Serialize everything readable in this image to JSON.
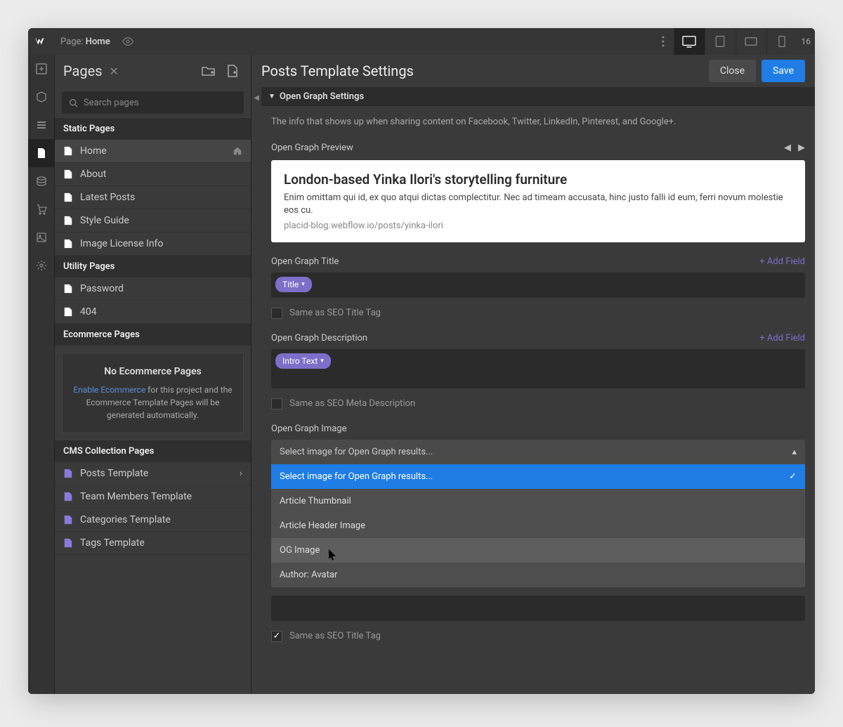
{
  "topbar": {
    "page_prefix": "Page:",
    "page_name": "Home",
    "resolution": "16"
  },
  "pages_panel": {
    "title": "Pages",
    "search_placeholder": "Search pages",
    "sections": {
      "static": "Static Pages",
      "utility": "Utility Pages",
      "ecommerce": "Ecommerce Pages",
      "cms": "CMS Collection Pages"
    },
    "static_items": [
      "Home",
      "About",
      "Latest Posts",
      "Style Guide",
      "Image License Info"
    ],
    "utility_items": [
      "Password",
      "404"
    ],
    "ecommerce_empty": {
      "title": "No Ecommerce Pages",
      "link": "Enable Ecommerce",
      "text_after": " for this project and the Ecommerce Template Pages will be generated automatically."
    },
    "cms_items": [
      "Posts Template",
      "Team Members Template",
      "Categories Template",
      "Tags Template"
    ]
  },
  "settings": {
    "title": "Posts Template Settings",
    "close": "Close",
    "save": "Save",
    "section": "Open Graph Settings",
    "description": "The info that shows up when sharing content on Facebook, Twitter, LinkedIn, Pinterest, and Google+.",
    "preview_label": "Open Graph Preview",
    "preview": {
      "title": "London-based Yinka Ilori's storytelling furniture",
      "desc": "Enim omittam qui id, ex quo atqui dictas complectitur. Nec ad timeam accusata, hinc justo falli id eum, ferri novum molestie eos cu.",
      "url": "placid-blog.webflow.io/posts/yinka-ilori"
    },
    "og_title_label": "Open Graph Title",
    "add_field": "+ Add Field",
    "title_pill": "Title",
    "same_as_seo_title": "Same as SEO Title Tag",
    "og_desc_label": "Open Graph Description",
    "intro_pill": "Intro Text",
    "same_as_seo_desc": "Same as SEO Meta Description",
    "og_image_label": "Open Graph Image",
    "select_placeholder": "Select image for Open Graph results...",
    "dropdown": [
      "Select image for Open Graph results...",
      "Article Thumbnail",
      "Article Header Image",
      "OG Image",
      "Author: Avatar"
    ],
    "same_as_seo_title_2": "Same as SEO Title Tag"
  }
}
